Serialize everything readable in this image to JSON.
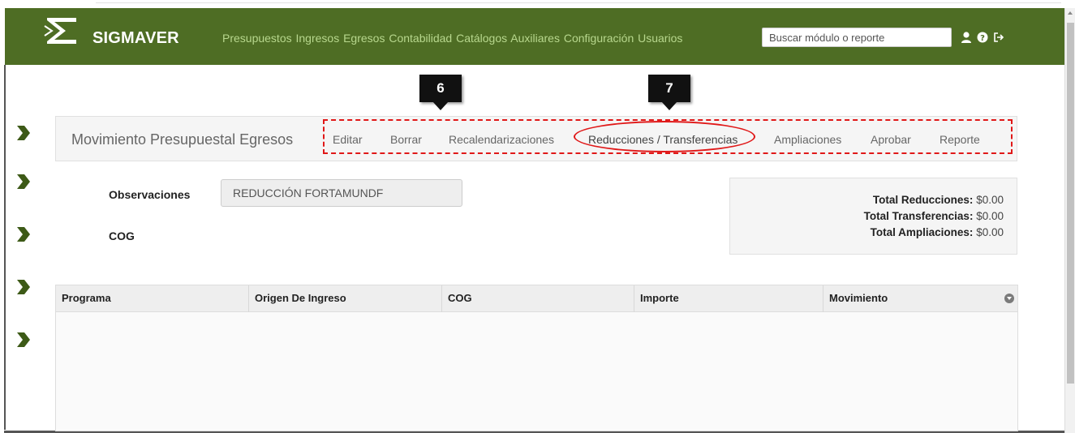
{
  "header": {
    "brand": "SIGMAVER",
    "menu": [
      "Presupuestos",
      "Ingresos",
      "Egresos",
      "Contabilidad",
      "Catálogos",
      "Auxiliares",
      "Configuración",
      "Usuarios"
    ],
    "search_placeholder": "Buscar módulo o reporte",
    "icons": [
      "user-icon",
      "help-icon",
      "logout-icon"
    ],
    "color": "#4e6d24",
    "menu_color": "#b7d78d"
  },
  "callouts": [
    "6",
    "7"
  ],
  "section": {
    "title": "Movimiento Presupuestal Egresos",
    "actions": {
      "editar": "Editar",
      "borrar": "Borrar",
      "recalendarizaciones": "Recalendarizaciones",
      "reducciones": "Reducciones / Transferencias",
      "ampliaciones": "Ampliaciones",
      "aprobar": "Aprobar",
      "reporte": "Reporte"
    },
    "highlight_color": "#e01818"
  },
  "form": {
    "observaciones_label": "Observaciones",
    "observaciones_value": "REDUCCIÓN FORTAMUNDF",
    "cog_label": "COG"
  },
  "totals": {
    "reducciones_label": "Total Reducciones:",
    "reducciones_value": "$0.00",
    "transferencias_label": "Total Transferencias:",
    "transferencias_value": "$0.00",
    "ampliaciones_label": "Total Ampliaciones:",
    "ampliaciones_value": "$0.00"
  },
  "grid": {
    "columns": [
      "Programa",
      "Origen De Ingreso",
      "COG",
      "Importe",
      "Movimiento"
    ],
    "rows": []
  }
}
